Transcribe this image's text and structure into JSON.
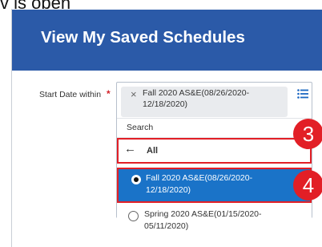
{
  "top_caption": "v is open",
  "page": {
    "title": "View My Saved Schedules"
  },
  "field": {
    "label": "Start Date within",
    "required_marker": "*"
  },
  "selector": {
    "selected_value": "Fall 2020 AS&E(08/26/2020-12/18/2020)",
    "remove_icon": "×",
    "search_label": "Search",
    "back_icon": "←",
    "back_label": "All",
    "options": [
      {
        "label": "Fall 2020 AS&E(08/26/2020-12/18/2020)",
        "selected": true
      },
      {
        "label": "Spring 2020 AS&E(01/15/2020-05/11/2020)",
        "selected": false
      }
    ]
  },
  "annotations": {
    "step_3": "3",
    "step_4": "4"
  },
  "colors": {
    "header_bg": "#2b5aa8",
    "selected_option_bg": "#1a73c8",
    "annotation_red": "#e21f26",
    "required_red": "#d3232a"
  },
  "icons": {
    "remove": "close-icon",
    "list": "list-icon",
    "back": "arrow-left-icon",
    "radio_selected": "radio-checked-icon",
    "radio_empty": "radio-unchecked-icon"
  }
}
